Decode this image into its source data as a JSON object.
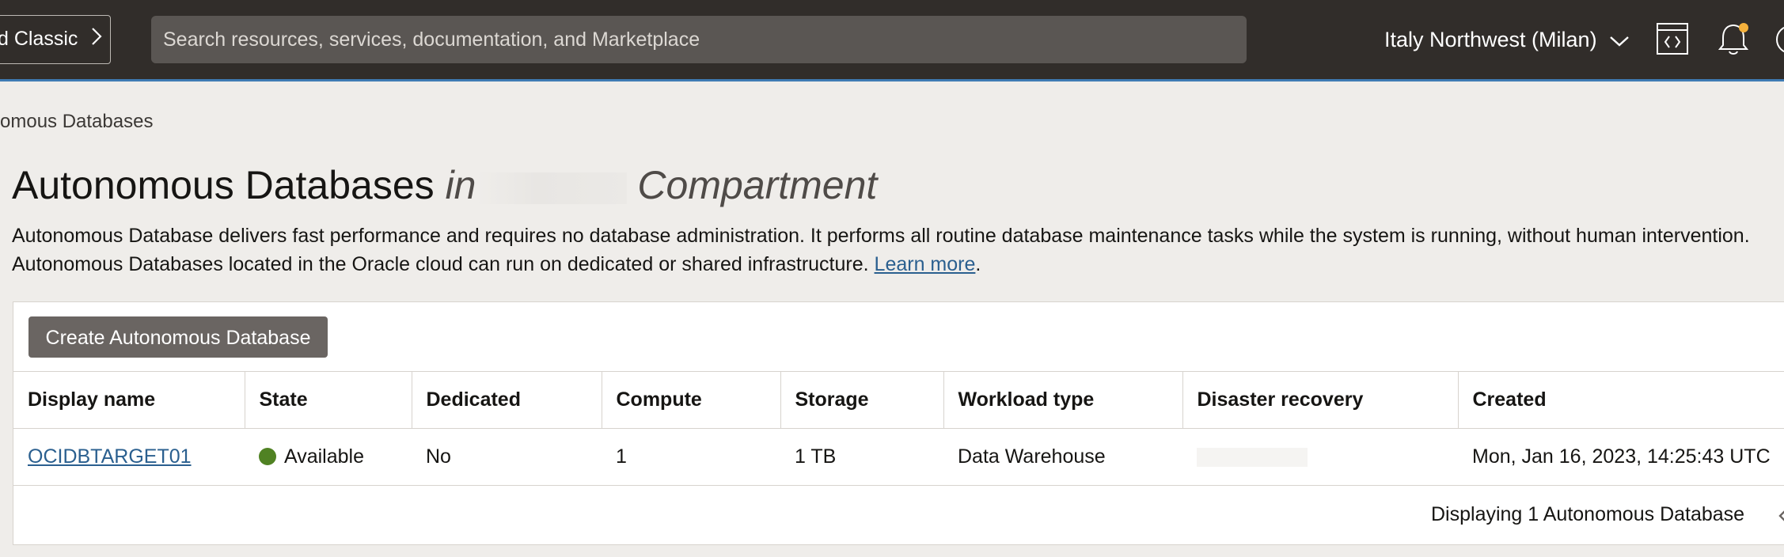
{
  "topbar": {
    "classic_label": "d Classic",
    "search_placeholder": "Search resources, services, documentation, and Marketplace",
    "region": "Italy Northwest (Milan)"
  },
  "breadcrumb": "omous Databases",
  "page": {
    "title": "Autonomous Databases",
    "title_in": "in",
    "title_compartment": "Compartment",
    "description_line1": "Autonomous Database delivers fast performance and requires no database administration. It performs all routine database maintenance tasks while the system is running, without human intervention.",
    "description_line2": "Autonomous Databases located in the Oracle cloud can run on dedicated or shared infrastructure.",
    "learn_more": "Learn more",
    "period": "."
  },
  "panel": {
    "create_button": "Create Autonomous Database",
    "columns": [
      "Display name",
      "State",
      "Dedicated",
      "Compute",
      "Storage",
      "Workload type",
      "Disaster recovery",
      "Created"
    ],
    "rows": [
      {
        "display_name": "OCIDBTARGET01",
        "state": "Available",
        "dedicated": "No",
        "compute": "1",
        "storage": "1 TB",
        "workload_type": "Data Warehouse",
        "disaster_recovery": "",
        "created": "Mon, Jan 16, 2023, 14:25:43 UTC"
      }
    ],
    "footer": "Displaying 1 Autonomous Database"
  },
  "colors": {
    "topbar": "#312d2a",
    "accent_line": "#3f7bb4",
    "link": "#2a5f8f",
    "available": "#508223",
    "button": "#6a6562"
  },
  "icons": [
    "chevron-right-icon",
    "chevron-down-icon",
    "code-editor-icon",
    "bell-icon",
    "help-icon",
    "chevron-left-icon"
  ]
}
